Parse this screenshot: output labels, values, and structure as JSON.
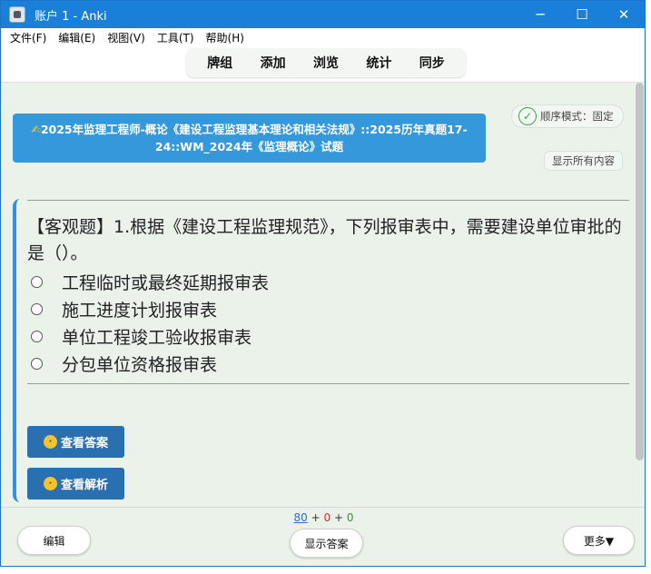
{
  "window": {
    "title": "账户 1 - Anki"
  },
  "menu": {
    "items": [
      "文件(F)",
      "编辑(E)",
      "视图(V)",
      "工具(T)",
      "帮助(H)"
    ]
  },
  "toolbar": {
    "items": [
      "牌组",
      "添加",
      "浏览",
      "统计",
      "同步"
    ]
  },
  "deck": {
    "title": "2025年监理工程师-概论《建设工程监理基本理论和相关法规》::2025历年真题17-24::WM_2024年《监理概论》试题"
  },
  "order_mode": {
    "label": "顺序模式：固定"
  },
  "show_all": {
    "label": "显示所有内容"
  },
  "question": {
    "text": "【客观题】1.根据《建设工程监理规范》，下列报审表中，需要建设单位审批的是（）。",
    "options": [
      "工程临时或最终延期报审表",
      "施工进度计划报审表",
      "单位工程竣工验收报审表",
      "分包单位资格报审表"
    ]
  },
  "actions": {
    "view_answer": "查看答案",
    "view_analysis": "查看解析"
  },
  "counts": {
    "new": "80",
    "learn": "0",
    "review": "0",
    "plus": "+"
  },
  "bottom": {
    "edit": "编辑",
    "show_answer": "显示答案",
    "more": "更多▼"
  },
  "colors": {
    "titlebar": "#1a7fd9",
    "banner": "#3498db",
    "action_button": "#2a6fb0",
    "card_bg": "#eaf2ea"
  }
}
